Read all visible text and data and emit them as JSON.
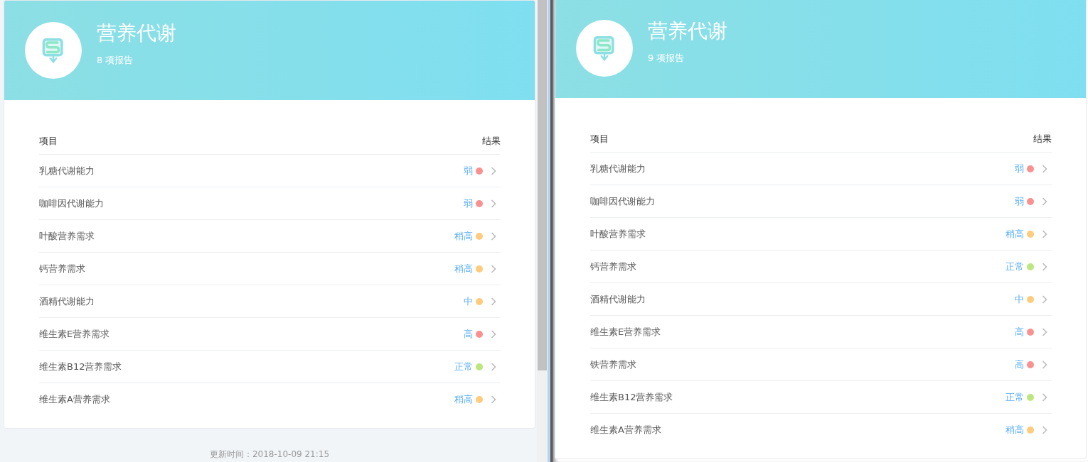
{
  "panels": [
    {
      "title": "营养代谢",
      "subtitle": "8 项报告",
      "columns": [
        "项目",
        "结果"
      ],
      "rows": [
        {
          "name": "乳糖代谢能力",
          "result": "弱",
          "color": "#fa9191"
        },
        {
          "name": "咖啡因代谢能力",
          "result": "弱",
          "color": "#fa9191"
        },
        {
          "name": "叶酸营养需求",
          "result": "稍高",
          "color": "#ffcb7c"
        },
        {
          "name": "钙营养需求",
          "result": "稍高",
          "color": "#ffcb7c"
        },
        {
          "name": "酒精代谢能力",
          "result": "中",
          "color": "#ffcb7c"
        },
        {
          "name": "维生素E营养需求",
          "result": "高",
          "color": "#fa9191"
        },
        {
          "name": "维生素B12营养需求",
          "result": "正常",
          "color": "#bce67f"
        },
        {
          "name": "维生素A营养需求",
          "result": "稍高",
          "color": "#ffcb7c"
        }
      ],
      "footer": "更新时间：2018-10-09 21:15"
    },
    {
      "title": "营养代谢",
      "subtitle": "9 项报告",
      "columns": [
        "项目",
        "结果"
      ],
      "rows": [
        {
          "name": "乳糖代谢能力",
          "result": "弱",
          "color": "#fa9191"
        },
        {
          "name": "咖啡因代谢能力",
          "result": "弱",
          "color": "#fa9191"
        },
        {
          "name": "叶酸营养需求",
          "result": "稍高",
          "color": "#ffcb7c"
        },
        {
          "name": "钙营养需求",
          "result": "正常",
          "color": "#bce67f"
        },
        {
          "name": "酒精代谢能力",
          "result": "中",
          "color": "#ffcb7c"
        },
        {
          "name": "维生素E营养需求",
          "result": "高",
          "color": "#fa9191"
        },
        {
          "name": "铁营养需求",
          "result": "高",
          "color": "#fa9191"
        },
        {
          "name": "维生素B12营养需求",
          "result": "正常",
          "color": "#bce67f"
        },
        {
          "name": "维生素A营养需求",
          "result": "稍高",
          "color": "#ffcb7c"
        }
      ]
    }
  ]
}
